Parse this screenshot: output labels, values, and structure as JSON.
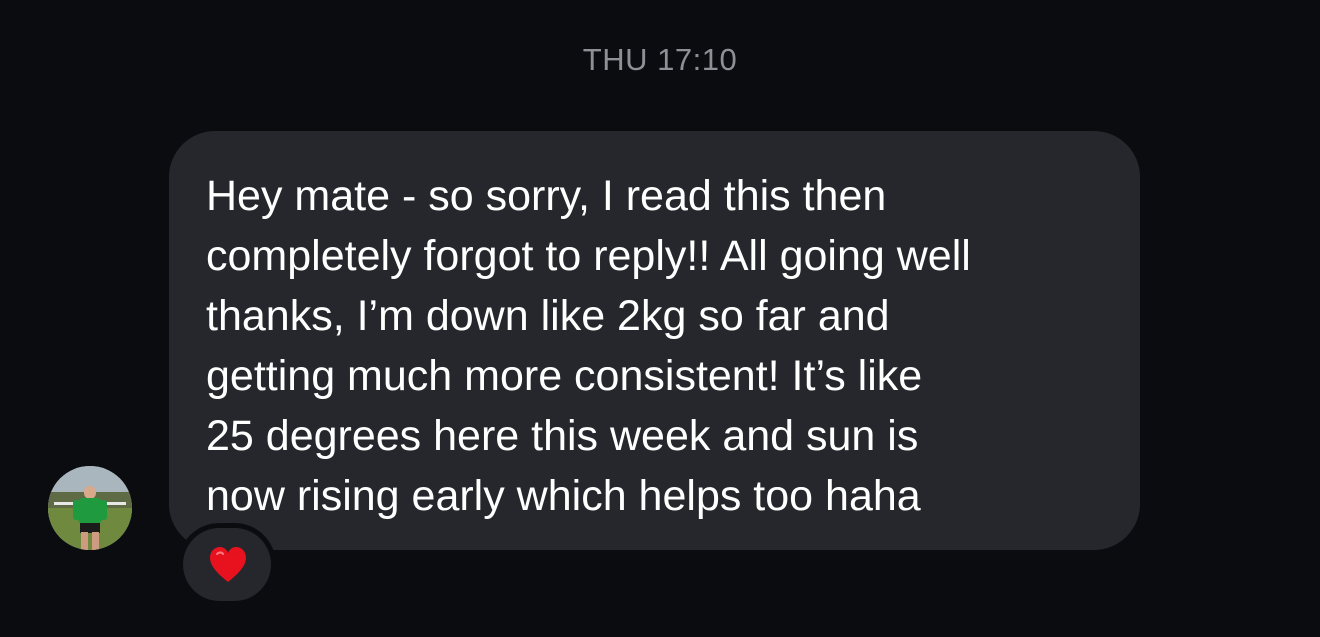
{
  "conversation": {
    "timestamp": "THU 17:10"
  },
  "message": {
    "lines": [
      "Hey mate - so sorry, I read this then",
      "completely forgot to reply!! All going well",
      "thanks, I’m down like 2kg so far and",
      "getting much more consistent! It’s like",
      "25 degrees here this week and sun is",
      "now rising early which helps too haha"
    ],
    "reaction_icon": "red-heart-icon",
    "reaction_color": "#e8121e"
  },
  "sender": {
    "avatar_icon": "profile-photo-avatar"
  },
  "colors": {
    "background": "#0b0c10",
    "bubble": "#26272c",
    "timestamp_text": "#8e9096",
    "message_text": "#ffffff"
  }
}
